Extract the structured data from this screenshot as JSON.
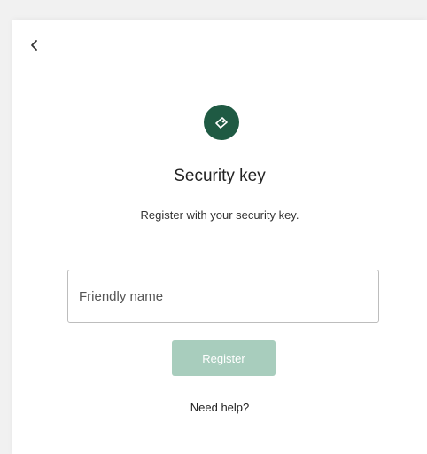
{
  "header": {
    "back_icon": "chevron-left-icon"
  },
  "hero": {
    "icon": "security-key-icon",
    "accent_color": "#1f5a43",
    "title": "Security key",
    "subtitle": "Register with your security key."
  },
  "form": {
    "name_placeholder": "Friendly name",
    "name_value": "",
    "register_label": "Register",
    "register_color": "#a8cdbd"
  },
  "footer": {
    "help_label": "Need help?"
  }
}
